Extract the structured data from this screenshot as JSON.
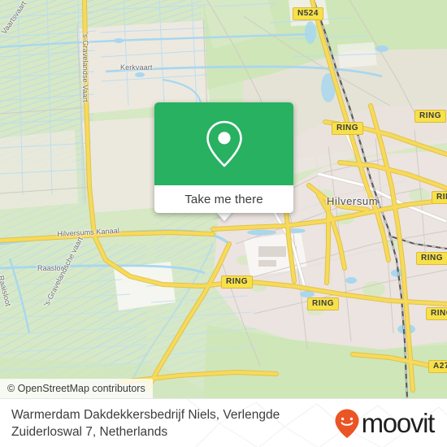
{
  "map": {
    "attribution": "© OpenStreetMap contributors",
    "city_label": "Hilversum",
    "labels": [
      {
        "text": "Kerkvaart"
      },
      {
        "text": "Hilversums Kanaal"
      },
      {
        "text": "Raasloot"
      },
      {
        "text": "Raaisloot"
      },
      {
        "text": "'s-Gravelandsche vaart"
      },
      {
        "text": "'s-Gravelandse Vaart"
      },
      {
        "text": "Vaartsvaart"
      }
    ],
    "shields": [
      {
        "label": "N524"
      },
      {
        "label": "RING"
      },
      {
        "label": "RING"
      },
      {
        "label": "RING"
      },
      {
        "label": "RING"
      },
      {
        "label": "RING"
      },
      {
        "label": "RING"
      },
      {
        "label": "RING"
      },
      {
        "label": "A27"
      }
    ],
    "colors": {
      "green_area": "#d7e8c4",
      "urban_area": "#ece4e0",
      "water": "#a8d7ef",
      "road_major": "#f7da5a",
      "shield_fill": "#f7e14a"
    }
  },
  "card": {
    "button_label": "Take me there",
    "pin_icon": "map-pin-icon",
    "accent_color": "#27b161"
  },
  "footer": {
    "place_name": "Warmerdam Dakdekkersbedrijf Niels, Verlengde Zuiderloswal 7, Netherlands",
    "brand_name": "moovit",
    "brand_color": "#eb5424"
  }
}
